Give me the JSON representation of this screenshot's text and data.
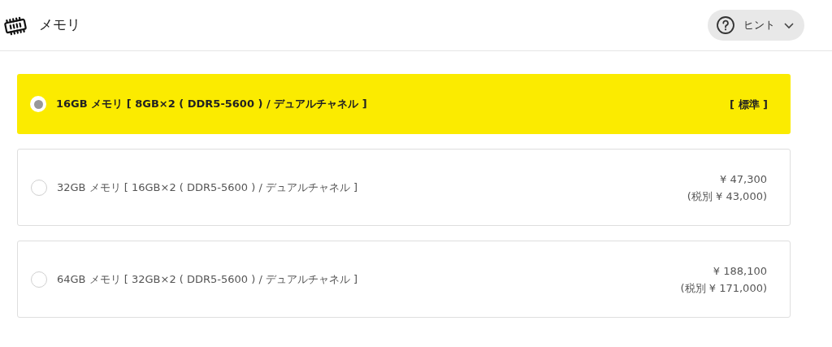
{
  "header": {
    "title": "メモリ",
    "hint_button": {
      "label": "ヒント"
    }
  },
  "options": [
    {
      "label": "16GB メモリ [ 8GB×2 ( DDR5-5600 ) / デュアルチャネル ]",
      "selected": true,
      "price_lines": [
        "[ 標準 ]"
      ]
    },
    {
      "label": "32GB メモリ [ 16GB×2 ( DDR5-5600 ) / デュアルチャネル ]",
      "selected": false,
      "price_lines": [
        "¥ 47,300",
        "(税別 ¥ 43,000)"
      ]
    },
    {
      "label": "64GB メモリ [ 32GB×2 ( DDR5-5600 ) / デュアルチャネル ]",
      "selected": false,
      "price_lines": [
        "¥ 188,100",
        "(税別 ¥ 171,000)"
      ]
    }
  ]
}
